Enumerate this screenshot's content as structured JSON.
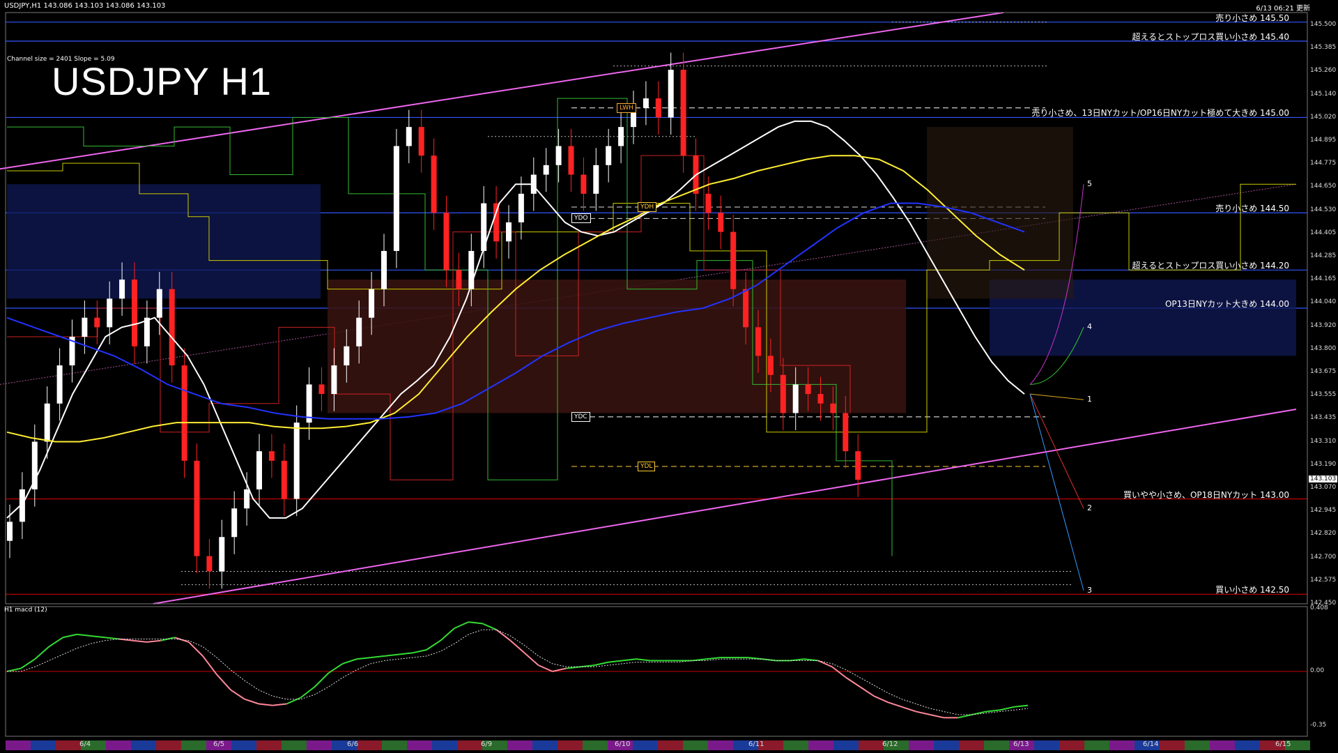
{
  "header": {
    "symbol_info": "USDJPY,H1  143.086 143.103 143.086 143.103",
    "updated": "6/13 06:21 更新",
    "channel_info": "Channel size = 2401 Slope = 5.09",
    "title": "USDJPY H1",
    "sub_window": "H1  macd (12)"
  },
  "chart_data": {
    "type": "candlestick",
    "title": "USDJPY H1",
    "ylim": [
      142.45,
      145.55
    ],
    "price_ticks": [
      "145.500",
      "145.385",
      "145.260",
      "145.140",
      "145.020",
      "144.895",
      "144.775",
      "144.650",
      "144.530",
      "144.405",
      "144.285",
      "144.165",
      "144.040",
      "143.920",
      "143.800",
      "143.675",
      "143.555",
      "143.435",
      "143.310",
      "143.190",
      "143.070",
      "142.945",
      "142.820",
      "142.700",
      "142.575",
      "142.450"
    ],
    "current_price": "143.103",
    "x_labels": [
      "6/4",
      "6/5",
      "6/6",
      "6/9",
      "6/10",
      "6/11",
      "6/12",
      "6/13",
      "6/14",
      "6/15"
    ],
    "levels": [
      {
        "price": 145.5,
        "label": "売り小さめ 145.50",
        "color": "#3355ff"
      },
      {
        "price": 145.4,
        "label": "超えるとストップロス買い小さめ 145.40",
        "color": "#3355ff"
      },
      {
        "price": 145.0,
        "label": "売り小さめ、13日NYカット/OP16日NYカット極めて大きめ 145.00",
        "color": "#3355ff"
      },
      {
        "price": 144.5,
        "label": "売り小さめ 144.50",
        "color": "#3355ff"
      },
      {
        "price": 144.2,
        "label": "超えるとストップロス買い小さめ 144.20",
        "color": "#3355ff"
      },
      {
        "price": 144.0,
        "label": "OP13日NYカット大きめ 144.00",
        "color": "#3355ff"
      },
      {
        "price": 143.0,
        "label": "買いやや小さめ、OP18日NYカット 143.00",
        "color": "#cc0000"
      },
      {
        "price": 142.5,
        "label": "買い小さめ 142.50",
        "color": "#cc0000"
      }
    ],
    "day_markers": [
      {
        "label": "YDO",
        "price": 144.47
      },
      {
        "label": "YDH",
        "price": 144.53
      },
      {
        "label": "YDC",
        "price": 143.43
      },
      {
        "label": "YDL",
        "price": 143.17
      },
      {
        "label": "LWH",
        "price": 145.05
      }
    ],
    "projection_labels": [
      "1",
      "2",
      "3",
      "4",
      "5"
    ],
    "macd": {
      "name": "H1 macd (12)",
      "ticks": [
        "0.408",
        "0.00",
        "-0.35"
      ],
      "ylim": [
        -0.42,
        0.42
      ],
      "main": [
        0.0,
        0.02,
        0.08,
        0.16,
        0.22,
        0.24,
        0.23,
        0.22,
        0.21,
        0.2,
        0.19,
        0.2,
        0.22,
        0.19,
        0.1,
        -0.02,
        -0.12,
        -0.18,
        -0.21,
        -0.22,
        -0.21,
        -0.17,
        -0.1,
        -0.01,
        0.05,
        0.08,
        0.09,
        0.1,
        0.11,
        0.12,
        0.14,
        0.2,
        0.28,
        0.32,
        0.31,
        0.27,
        0.2,
        0.12,
        0.04,
        0.0,
        0.02,
        0.03,
        0.04,
        0.06,
        0.07,
        0.08,
        0.07,
        0.07,
        0.07,
        0.07,
        0.08,
        0.09,
        0.09,
        0.09,
        0.08,
        0.07,
        0.07,
        0.08,
        0.07,
        0.03,
        -0.04,
        -0.1,
        -0.16,
        -0.2,
        -0.23,
        -0.26,
        -0.28,
        -0.3,
        -0.3,
        -0.28,
        -0.26,
        -0.25,
        -0.23,
        -0.22
      ],
      "signal": [
        0.0,
        0.0,
        0.03,
        0.07,
        0.11,
        0.15,
        0.18,
        0.2,
        0.21,
        0.21,
        0.21,
        0.21,
        0.21,
        0.2,
        0.16,
        0.09,
        0.01,
        -0.06,
        -0.12,
        -0.16,
        -0.18,
        -0.18,
        -0.15,
        -0.1,
        -0.04,
        0.01,
        0.05,
        0.07,
        0.08,
        0.09,
        0.1,
        0.13,
        0.18,
        0.24,
        0.27,
        0.27,
        0.23,
        0.17,
        0.1,
        0.05,
        0.03,
        0.03,
        0.03,
        0.04,
        0.05,
        0.06,
        0.06,
        0.06,
        0.06,
        0.07,
        0.07,
        0.08,
        0.08,
        0.08,
        0.08,
        0.07,
        0.07,
        0.07,
        0.07,
        0.05,
        0.01,
        -0.04,
        -0.09,
        -0.14,
        -0.18,
        -0.21,
        -0.24,
        -0.26,
        -0.28,
        -0.28,
        -0.27,
        -0.26,
        -0.25,
        -0.24
      ]
    },
    "series": [
      {
        "name": "close",
        "values": [
          142.88,
          143.05,
          143.3,
          143.5,
          143.7,
          143.85,
          143.95,
          143.9,
          144.05,
          144.15,
          143.8,
          143.95,
          144.1,
          143.7,
          143.2,
          142.7,
          142.62,
          142.8,
          142.95,
          143.05,
          143.25,
          143.2,
          143.0,
          143.4,
          143.6,
          143.55,
          143.7,
          143.8,
          143.95,
          144.1,
          144.3,
          144.85,
          144.95,
          144.8,
          144.5,
          144.2,
          144.1,
          144.3,
          144.55,
          144.35,
          144.45,
          144.6,
          144.7,
          144.75,
          144.85,
          144.7,
          144.6,
          144.75,
          144.85,
          144.95,
          145.05,
          145.1,
          145.0,
          145.25,
          144.8,
          144.6,
          144.5,
          144.4,
          144.1,
          143.9,
          143.75,
          143.65,
          143.45,
          143.6,
          143.55,
          143.5,
          143.45,
          143.25,
          143.1
        ]
      },
      {
        "name": "SMA white",
        "values": [
          142.9,
          142.98,
          143.15,
          143.35,
          143.55,
          143.7,
          143.85,
          143.9,
          143.92,
          143.95,
          143.85,
          143.75,
          143.6,
          143.4,
          143.2,
          143.0,
          142.9,
          142.9,
          142.95,
          143.05,
          143.15,
          143.25,
          143.35,
          143.45,
          143.55,
          143.62,
          143.7,
          143.85,
          144.05,
          144.3,
          144.55,
          144.65,
          144.65,
          144.55,
          144.45,
          144.4,
          144.38,
          144.4,
          144.45,
          144.5,
          144.55,
          144.62,
          144.7,
          144.75,
          144.8,
          144.85,
          144.9,
          144.95,
          144.98,
          144.98,
          144.95,
          144.88,
          144.8,
          144.7,
          144.58,
          144.45,
          144.3,
          144.15,
          144.0,
          143.85,
          143.72,
          143.62,
          143.55
        ]
      },
      {
        "name": "SMA yellow",
        "values": [
          143.35,
          143.32,
          143.3,
          143.3,
          143.32,
          143.35,
          143.38,
          143.4,
          143.4,
          143.4,
          143.4,
          143.38,
          143.37,
          143.37,
          143.38,
          143.4,
          143.45,
          143.55,
          143.7,
          143.85,
          143.98,
          144.1,
          144.2,
          144.28,
          144.35,
          144.42,
          144.48,
          144.55,
          144.6,
          144.65,
          144.68,
          144.72,
          144.75,
          144.78,
          144.8,
          144.8,
          144.78,
          144.72,
          144.62,
          144.5,
          144.38,
          144.28,
          144.2
        ]
      },
      {
        "name": "SMA blue",
        "values": [
          143.95,
          143.9,
          143.85,
          143.8,
          143.75,
          143.68,
          143.6,
          143.55,
          143.5,
          143.48,
          143.45,
          143.43,
          143.42,
          143.42,
          143.42,
          143.43,
          143.45,
          143.5,
          143.58,
          143.66,
          143.75,
          143.82,
          143.88,
          143.92,
          143.95,
          143.98,
          144.0,
          144.05,
          144.12,
          144.22,
          144.32,
          144.42,
          144.5,
          144.55,
          144.55,
          144.53,
          144.5,
          144.45,
          144.4
        ]
      }
    ]
  }
}
